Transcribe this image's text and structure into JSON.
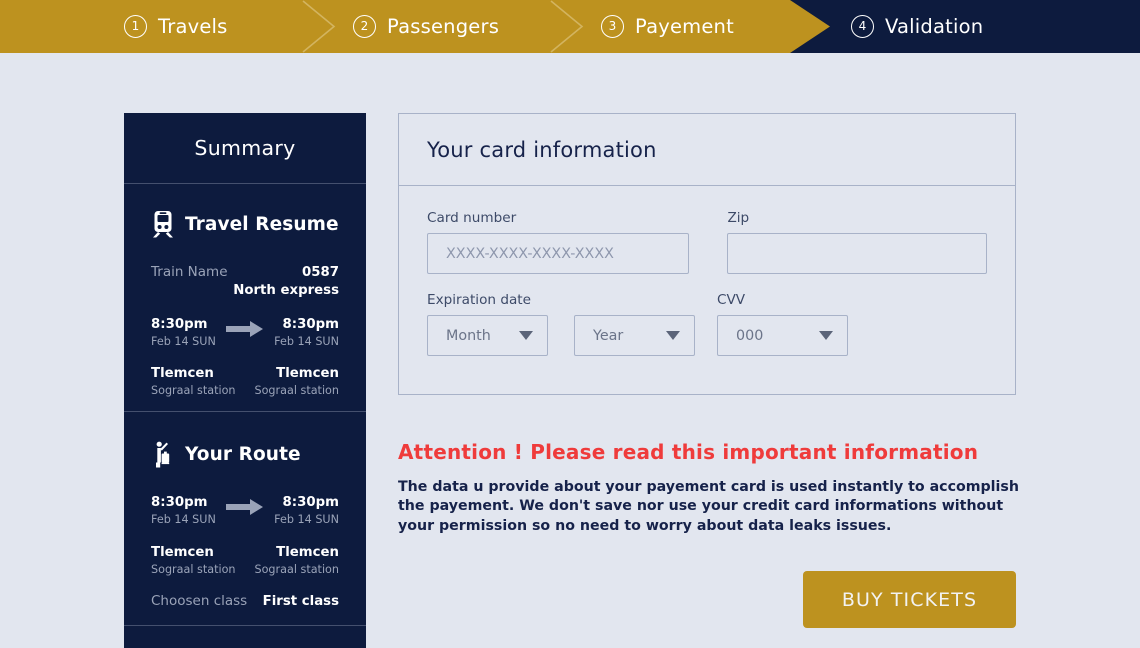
{
  "theme": {
    "gold": "#bd921f",
    "navy": "#0d1b3e",
    "background": "#e2e6ef",
    "alert_red": "#ef3b3b",
    "muted_text": "#9aa3b8",
    "border": "#a8b2c8"
  },
  "stepper": {
    "steps": [
      {
        "number": "1",
        "label": "Travels",
        "state": "done"
      },
      {
        "number": "2",
        "label": "Passengers",
        "state": "done"
      },
      {
        "number": "3",
        "label": "Payement",
        "state": "done"
      },
      {
        "number": "4",
        "label": "Validation",
        "state": "active"
      }
    ]
  },
  "sidebar": {
    "title": "Summary",
    "resume": {
      "icon": "train-icon",
      "heading": "Travel Resume",
      "train_label": "Train Name",
      "train_number": "0587",
      "train_name": "North express",
      "depart_time": "8:30pm",
      "depart_date": "Feb 14 SUN",
      "arrive_time": "8:30pm",
      "arrive_date": "Feb 14 SUN",
      "depart_city": "Tlemcen",
      "depart_station": "Sograal station",
      "arrive_city": "Tlemcen",
      "arrive_station": "Sograal station"
    },
    "route": {
      "icon": "passenger-luggage-icon",
      "heading": "Your Route",
      "depart_time": "8:30pm",
      "depart_date": "Feb 14 SUN",
      "arrive_time": "8:30pm",
      "arrive_date": "Feb 14 SUN",
      "depart_city": "Tlemcen",
      "depart_station": "Sograal station",
      "arrive_city": "Tlemcen",
      "arrive_station": "Sograal station",
      "class_label": "Choosen class",
      "class_value": "First class"
    }
  },
  "card_panel": {
    "title": "Your card information",
    "card_number": {
      "label": "Card number",
      "value": "",
      "placeholder": "XXXX-XXXX-XXXX-XXXX"
    },
    "zip": {
      "label": "Zip",
      "value": "",
      "placeholder": ""
    },
    "expiration": {
      "label": "Expiration date",
      "month_selected": "Month",
      "year_selected": "Year"
    },
    "cvv": {
      "label": "CVV",
      "selected": "000"
    }
  },
  "attention": {
    "title": "Attention ! Please read this important information",
    "body": "The data u provide about your payement card is used instantly to accomplish the payement. We don't save nor use your credit card informations without your permission so no need to worry about data leaks issues."
  },
  "actions": {
    "buy_label": "BUY TICKETS"
  }
}
